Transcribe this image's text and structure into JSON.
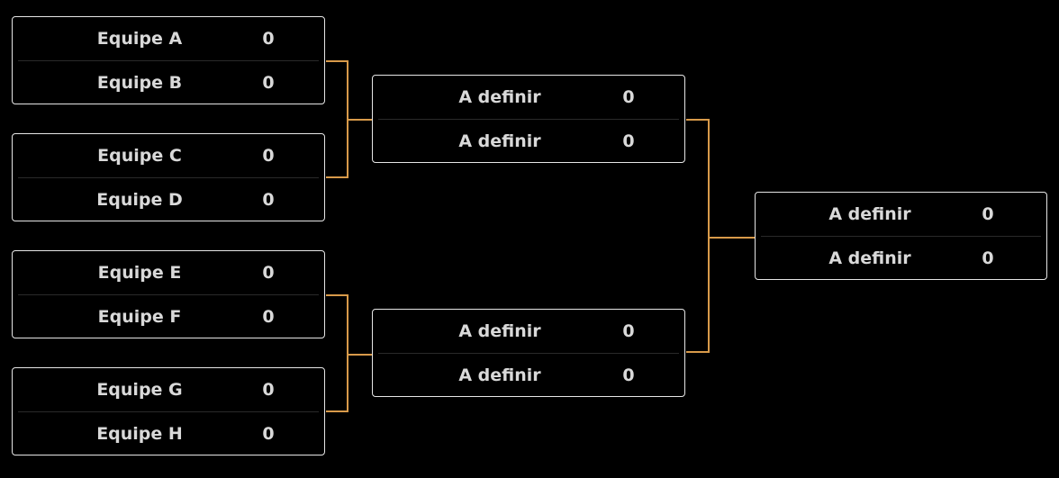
{
  "bracket": {
    "round1": [
      {
        "team1": "Equipe A",
        "score1": "0",
        "team2": "Equipe B",
        "score2": "0"
      },
      {
        "team1": "Equipe C",
        "score1": "0",
        "team2": "Equipe D",
        "score2": "0"
      },
      {
        "team1": "Equipe E",
        "score1": "0",
        "team2": "Equipe F",
        "score2": "0"
      },
      {
        "team1": "Equipe G",
        "score1": "0",
        "team2": "Equipe H",
        "score2": "0"
      }
    ],
    "round2": [
      {
        "team1": "A definir",
        "score1": "0",
        "team2": "A definir",
        "score2": "0"
      },
      {
        "team1": "A definir",
        "score1": "0",
        "team2": "A definir",
        "score2": "0"
      }
    ],
    "final": [
      {
        "team1": "A definir",
        "score1": "0",
        "team2": "A definir",
        "score2": "0"
      }
    ]
  },
  "colors": {
    "background": "#000000",
    "card_border": "#e6e6e6",
    "text": "#d9d9d9",
    "connector": "#d89a4a",
    "divider": "#2a2a2a"
  }
}
